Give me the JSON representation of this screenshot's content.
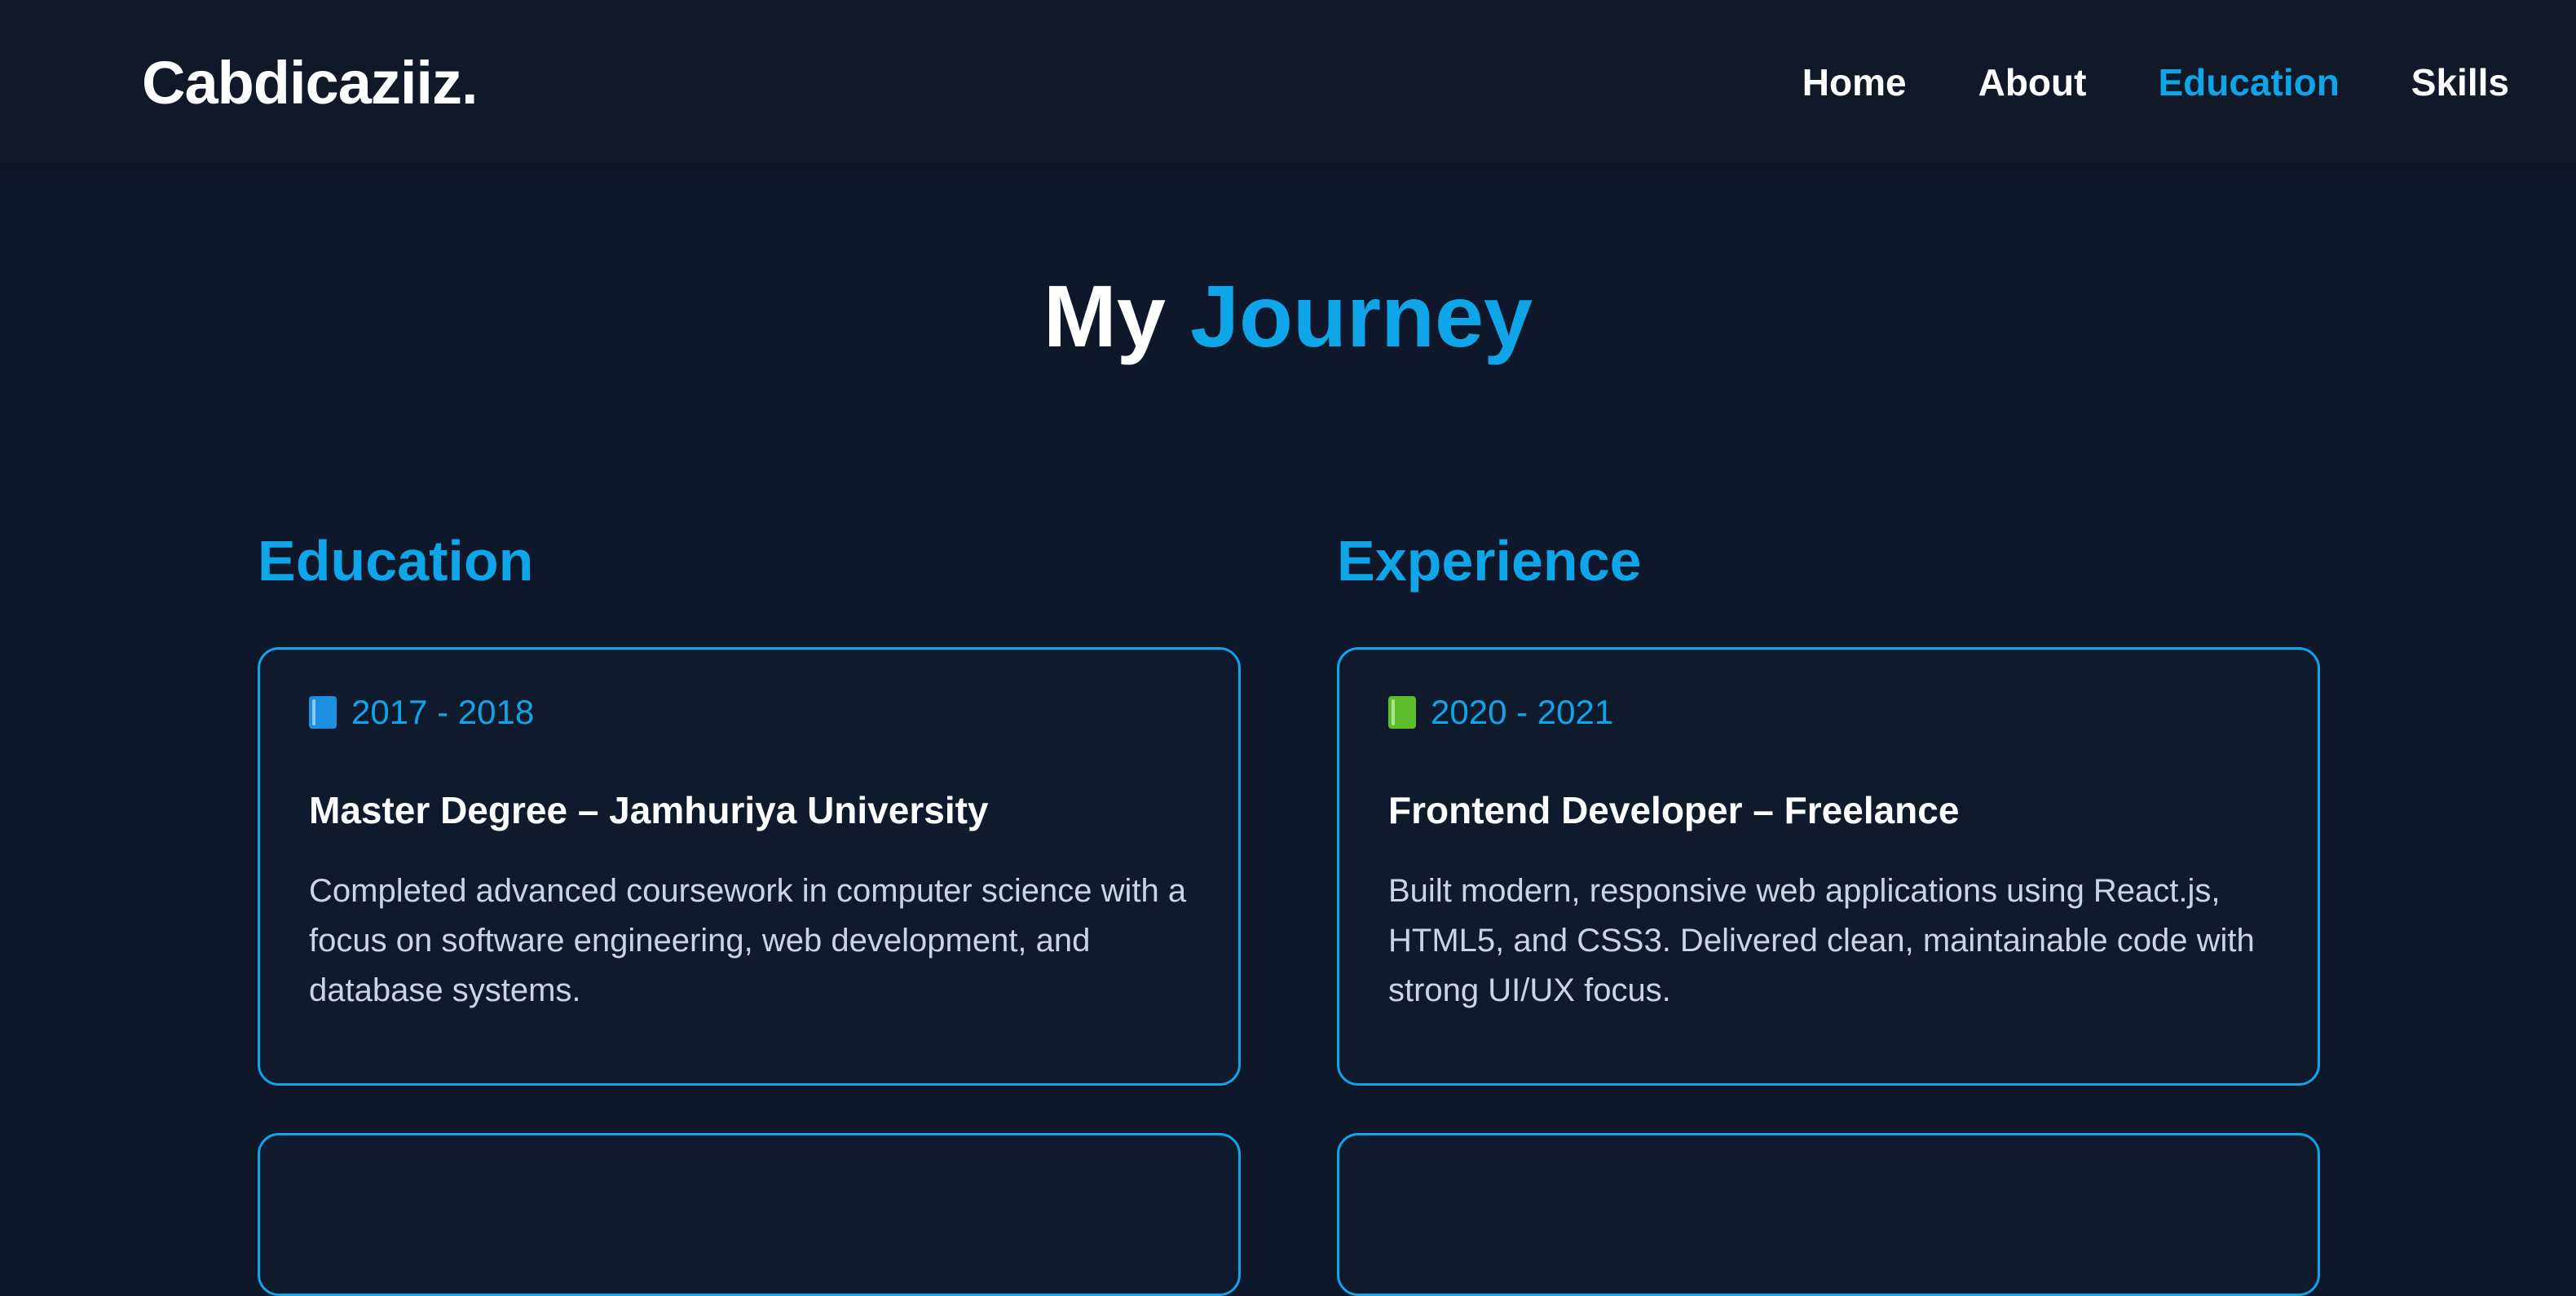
{
  "header": {
    "brand": "Cabdicaziiz.",
    "nav": [
      {
        "label": "Home",
        "active": false
      },
      {
        "label": "About",
        "active": false
      },
      {
        "label": "Education",
        "active": true
      },
      {
        "label": "Skills",
        "active": false
      }
    ]
  },
  "title": {
    "part1": "My",
    "part2": "Journey"
  },
  "education": {
    "heading": "Education",
    "items": [
      {
        "icon": "blue-book-icon",
        "date": "2017 - 2018",
        "title": "Master Degree – Jamhuriya University",
        "description": "Completed advanced coursework in computer science with a focus on software engineering, web development, and database systems."
      }
    ]
  },
  "experience": {
    "heading": "Experience",
    "items": [
      {
        "icon": "green-book-icon",
        "date": "2020 - 2021",
        "title": "Frontend Developer – Freelance",
        "description": "Built modern, responsive web applications using React.js, HTML5, and CSS3. Delivered clean, maintainable code with strong UI/UX focus."
      }
    ]
  },
  "colors": {
    "background": "#0f172a",
    "header_background": "#111827",
    "accent": "#0ea5e9",
    "text": "#ffffff",
    "muted_text": "#cbd5e1"
  }
}
